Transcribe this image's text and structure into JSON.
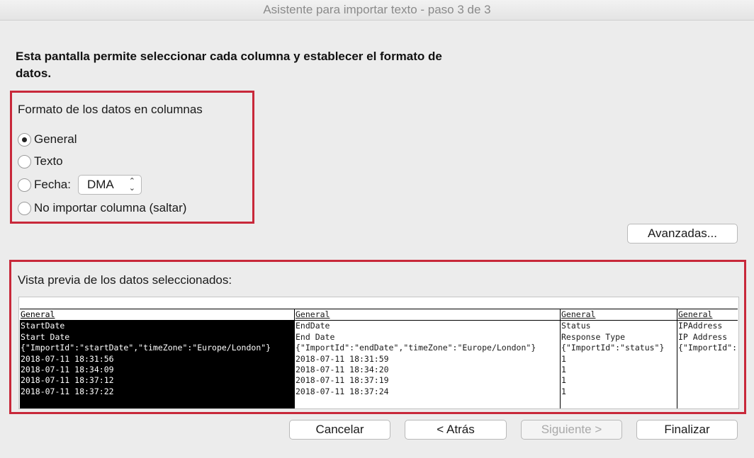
{
  "window": {
    "title": "Asistente para importar texto - paso 3 de 3"
  },
  "instructions": "Esta pantalla permite seleccionar cada columna y establecer el formato de datos.",
  "format_group": {
    "title": "Formato de los datos en columnas",
    "options": [
      {
        "label": "General",
        "selected": true
      },
      {
        "label": "Texto",
        "selected": false
      },
      {
        "label": "Fecha:",
        "selected": false
      },
      {
        "label": "No importar columna (saltar)",
        "selected": false
      }
    ],
    "date_format": {
      "value": "DMA",
      "icon": "chevron-updown-icon"
    }
  },
  "advanced_button": "Avanzadas...",
  "preview": {
    "title": "Vista previa de los datos seleccionados:",
    "columns": [
      {
        "header": "General",
        "selected": true,
        "cells": [
          "StartDate",
          "Start Date",
          "{\"ImportId\":\"startDate\",\"timeZone\":\"Europe/London\"}",
          "2018-07-11 18:31:56",
          "2018-07-11 18:34:09",
          "2018-07-11 18:37:12",
          "2018-07-11 18:37:22"
        ]
      },
      {
        "header": "General",
        "selected": false,
        "cells": [
          "EndDate",
          "End Date",
          "{\"ImportId\":\"endDate\",\"timeZone\":\"Europe/London\"}",
          "2018-07-11 18:31:59",
          "2018-07-11 18:34:20",
          "2018-07-11 18:37:19",
          "2018-07-11 18:37:24"
        ]
      },
      {
        "header": "General",
        "selected": false,
        "cells": [
          "Status",
          "Response Type",
          "{\"ImportId\":\"status\"}",
          "1",
          "1",
          "1",
          "1"
        ]
      },
      {
        "header": "General",
        "selected": false,
        "cells": [
          "IPAddress",
          "IP Address",
          "{\"ImportId\":",
          "",
          "",
          "",
          ""
        ]
      }
    ]
  },
  "buttons": {
    "cancel": "Cancelar",
    "back": "< Atrás",
    "next": "Siguiente >",
    "finish": "Finalizar"
  },
  "colors": {
    "highlight_border": "#c8283a",
    "background": "#ececec"
  }
}
